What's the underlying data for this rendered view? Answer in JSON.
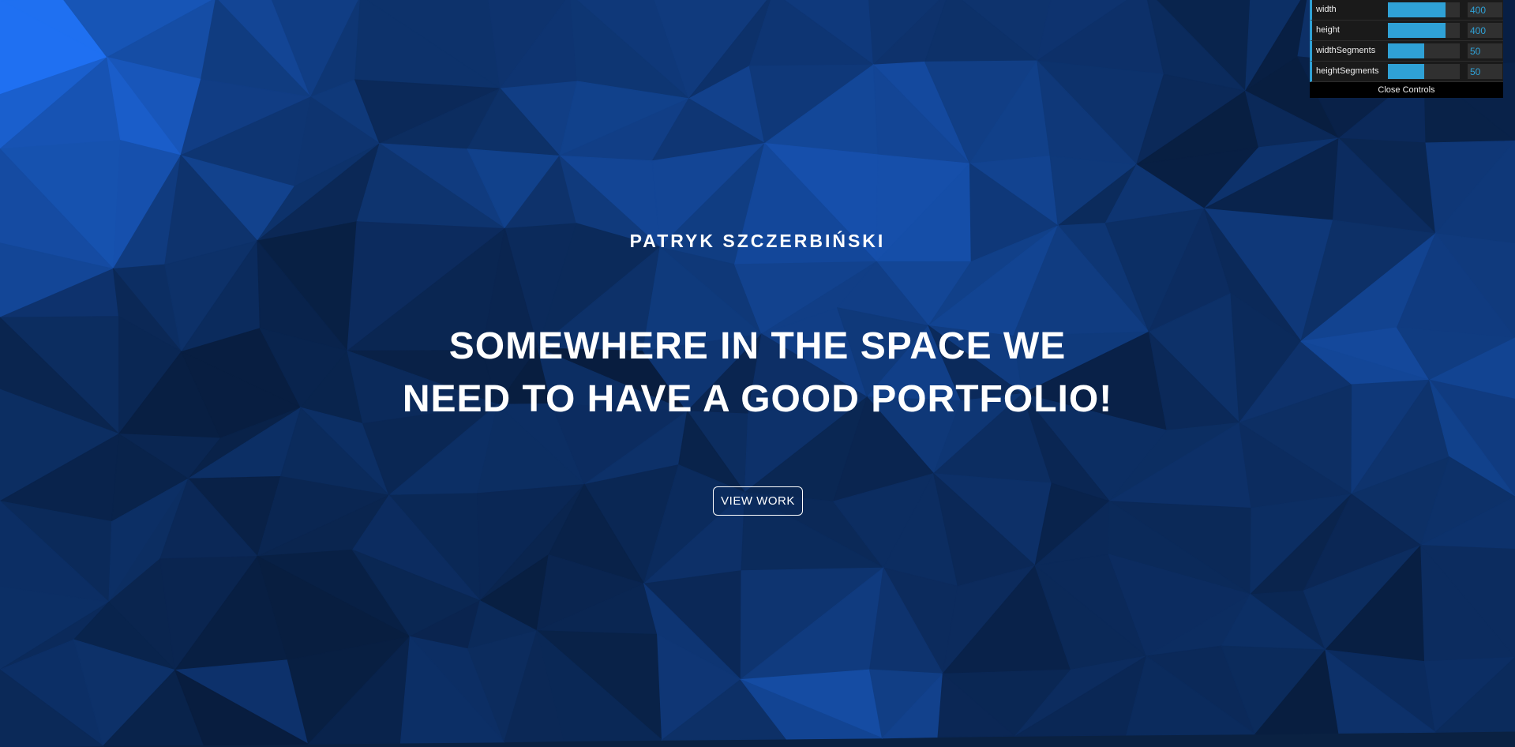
{
  "hero": {
    "author": "PATRYK SZCZERBIŃSKI",
    "headline_line1": "SOMEWHERE IN THE SPACE WE",
    "headline_line2": "NEED TO HAVE A GOOD PORTFOLIO!",
    "cta_label": "VIEW WORK"
  },
  "controls": {
    "rows": [
      {
        "label": "width",
        "value": "400",
        "fill": 0.8
      },
      {
        "label": "height",
        "value": "400",
        "fill": 0.8
      },
      {
        "label": "widthSegments",
        "value": "50",
        "fill": 0.5
      },
      {
        "label": "heightSegments",
        "value": "50",
        "fill": 0.5
      }
    ],
    "close_label": "Close Controls"
  },
  "colors": {
    "background_base": "#0a2142",
    "highlight_blue": "#1565d8",
    "accent": "#2fa1d6",
    "text": "#ffffff"
  }
}
